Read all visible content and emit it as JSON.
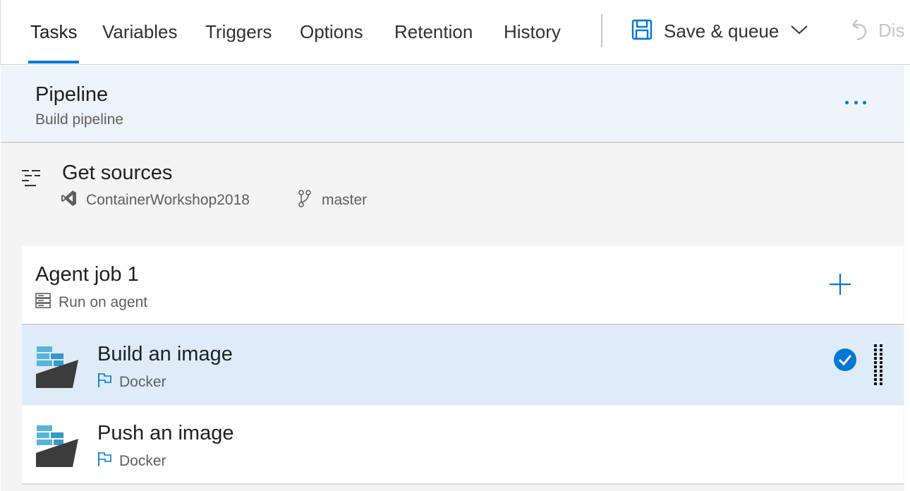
{
  "tabs": [
    {
      "label": "Tasks",
      "active": true
    },
    {
      "label": "Variables"
    },
    {
      "label": "Triggers"
    },
    {
      "label": "Options"
    },
    {
      "label": "Retention"
    },
    {
      "label": "History"
    }
  ],
  "toolbar": {
    "save_label": "Save & queue",
    "save_icon": "save-icon",
    "discard_label": "Dis",
    "discard_icon": "undo-icon"
  },
  "pipeline": {
    "title": "Pipeline",
    "subtitle": "Build pipeline"
  },
  "get_sources": {
    "title": "Get sources",
    "repo": "ContainerWorkshop2018",
    "branch": "master"
  },
  "agent_job": {
    "title": "Agent job 1",
    "subtitle": "Run on agent"
  },
  "tasks": [
    {
      "title": "Build an image",
      "type": "Docker",
      "selected": true
    },
    {
      "title": "Push an image",
      "type": "Docker",
      "selected": false
    }
  ],
  "colors": {
    "accent": "#0078d4",
    "pipeline_bg": "#eef4fb",
    "selected_bg": "#deecf9",
    "sources_bg": "#f4f4f4"
  }
}
